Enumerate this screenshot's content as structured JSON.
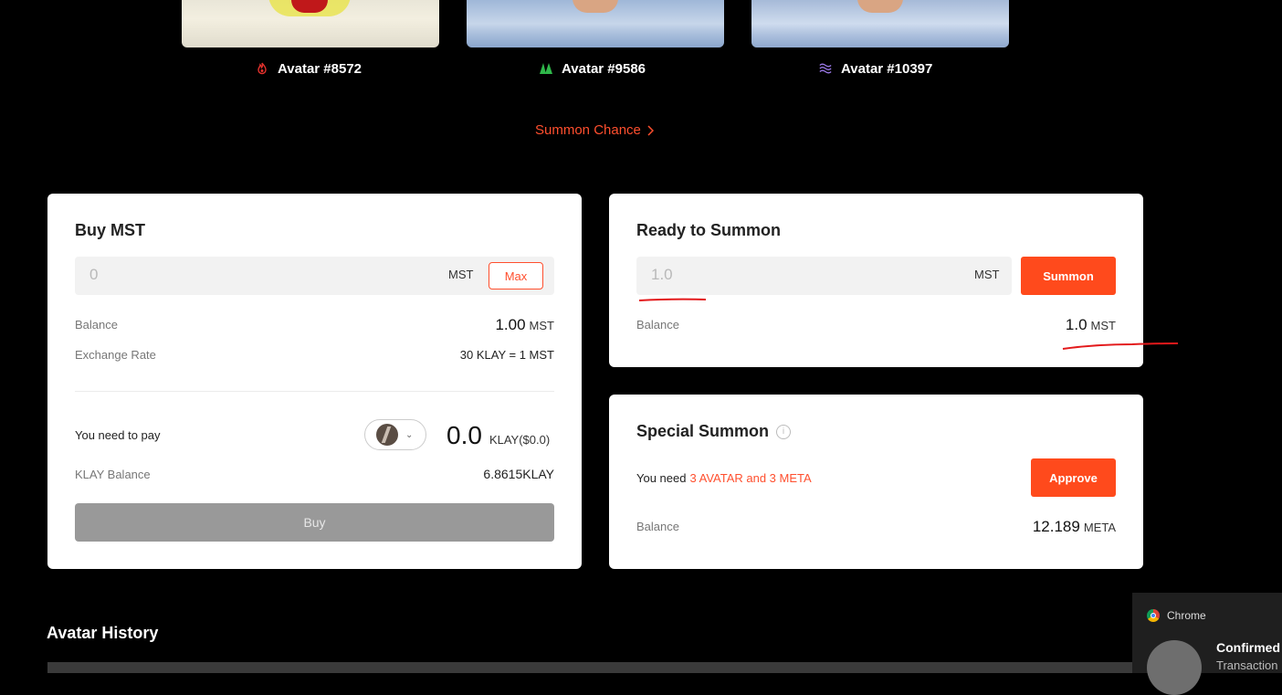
{
  "avatars": [
    {
      "name": "Avatar #8572",
      "element_icon": "fire-icon",
      "color": "#e5322d"
    },
    {
      "name": "Avatar #9586",
      "element_icon": "leaf-icon",
      "color": "#2fb84a"
    },
    {
      "name": "Avatar #10397",
      "element_icon": "wave-icon",
      "color": "#9b79e8"
    }
  ],
  "summon_chance": {
    "label": "Summon Chance",
    "icon": "chevron-right-icon"
  },
  "buy_mst": {
    "title": "Buy MST",
    "input_value": "0",
    "input_unit": "MST",
    "max_label": "Max",
    "balance_label": "Balance",
    "balance_value": "1.00",
    "balance_unit": "MST",
    "exchange_label": "Exchange Rate",
    "exchange_value": "30 KLAY = 1 MST",
    "pay_label": "You need to pay",
    "pay_token_icon": "klay-logo-icon",
    "pay_value": "0.0",
    "pay_unit": "KLAY($0.0)",
    "klay_balance_label": "KLAY Balance",
    "klay_balance_value": "6.8615KLAY",
    "buy_label": "Buy"
  },
  "ready_summon": {
    "title": "Ready to Summon",
    "input_value": "1.0",
    "input_unit": "MST",
    "summon_label": "Summon",
    "balance_label": "Balance",
    "balance_value": "1.0",
    "balance_unit": "MST"
  },
  "special_summon": {
    "title": "Special Summon",
    "info_icon": "info-icon",
    "need_prefix": "You need",
    "need_requirement": "3 AVATAR and 3 META",
    "approve_label": "Approve",
    "balance_label": "Balance",
    "balance_value": "12.189",
    "balance_unit": "META"
  },
  "history": {
    "title": "Avatar History"
  },
  "notification": {
    "app": "Chrome",
    "title": "Confirmed",
    "subtitle": "Transaction"
  },
  "colors": {
    "accent": "#ff4a1c",
    "background": "#000000",
    "panel": "#ffffff"
  }
}
